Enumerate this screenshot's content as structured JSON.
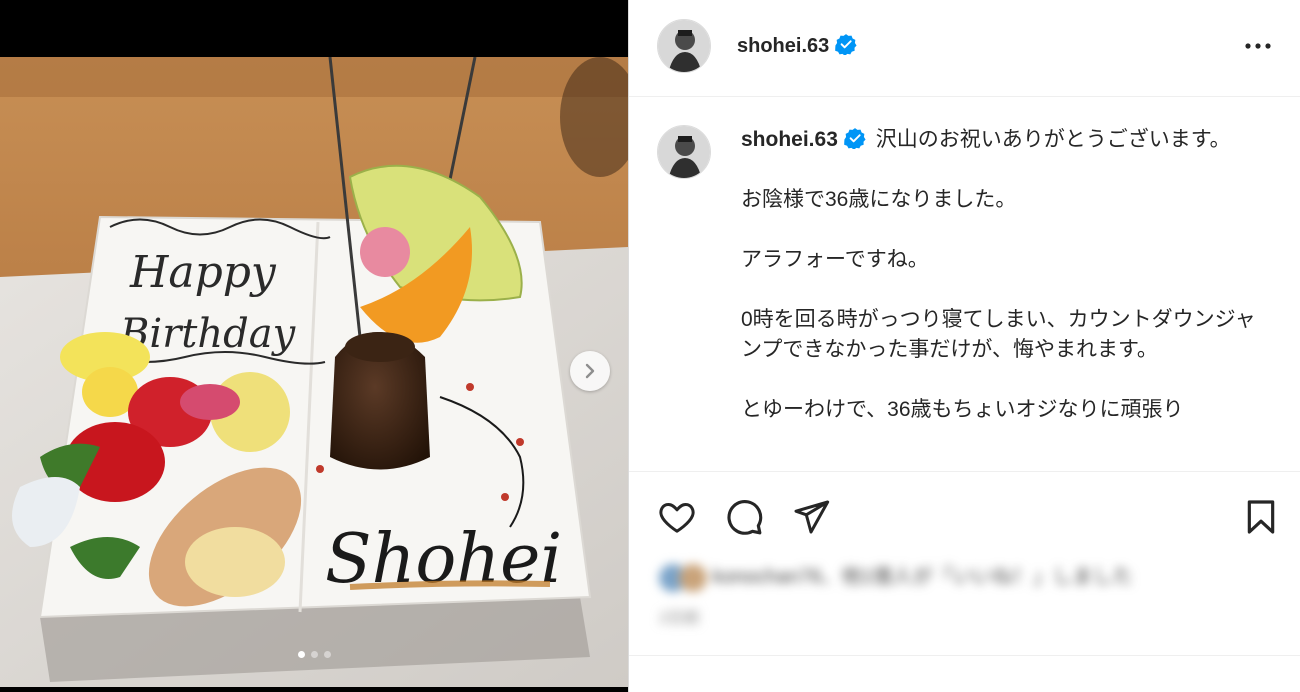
{
  "post": {
    "username": "shohei.63",
    "caption_lines": [
      "沢山のお祝いありがとうございます。",
      "",
      "お陰様で36歳になりました。",
      "",
      "アラフォーですね。",
      "",
      "0時を回る時がっつり寝てしまい、カウントダウンジャンプできなかった事だけが、悔やまれます。",
      "",
      "とゆーわけで、36歳もちょいオジなりに頑張り"
    ],
    "likes_text": "konochan76、他1億人が「いいね！」しました",
    "likes_date": "2日前"
  },
  "plate": {
    "top_text_1": "Happy",
    "top_text_2": "Birthday",
    "name_text": "Shohei"
  },
  "carousel": {
    "count": 3,
    "active": 0
  },
  "icons": {
    "verified": "verified-badge-icon",
    "more": "more-options-icon",
    "like": "heart-icon",
    "comment": "comment-icon",
    "share": "send-icon",
    "save": "bookmark-icon",
    "next": "chevron-right-icon"
  },
  "colors": {
    "verified": "#0095f6",
    "text": "#262626"
  }
}
